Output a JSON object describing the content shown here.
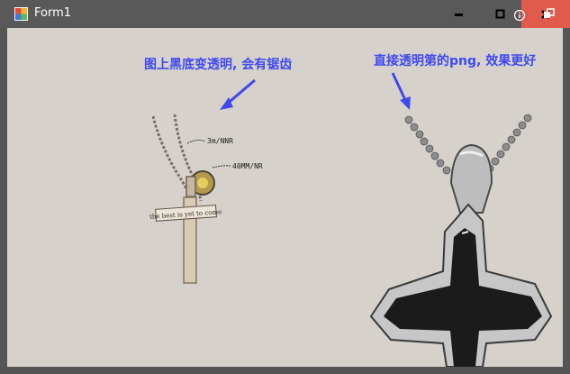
{
  "window": {
    "title": "Form1"
  },
  "controls": {
    "minimize_icon": "minimize-icon",
    "maximize_icon": "maximize-icon",
    "close_icon": "close-icon"
  },
  "captions": {
    "left": "图上黑底变透明, 会有锯齿",
    "right": "直接透明第的png, 效果更好"
  },
  "pendant_small": {
    "line1": "3m/NNR",
    "line2": "40MM/NR",
    "banner": "the best is yet to come"
  },
  "colors": {
    "accent_text": "#3f49ee",
    "close_button": "#e05b4b",
    "titlebar": "#595959",
    "client_bg": "#d6d2cb"
  }
}
